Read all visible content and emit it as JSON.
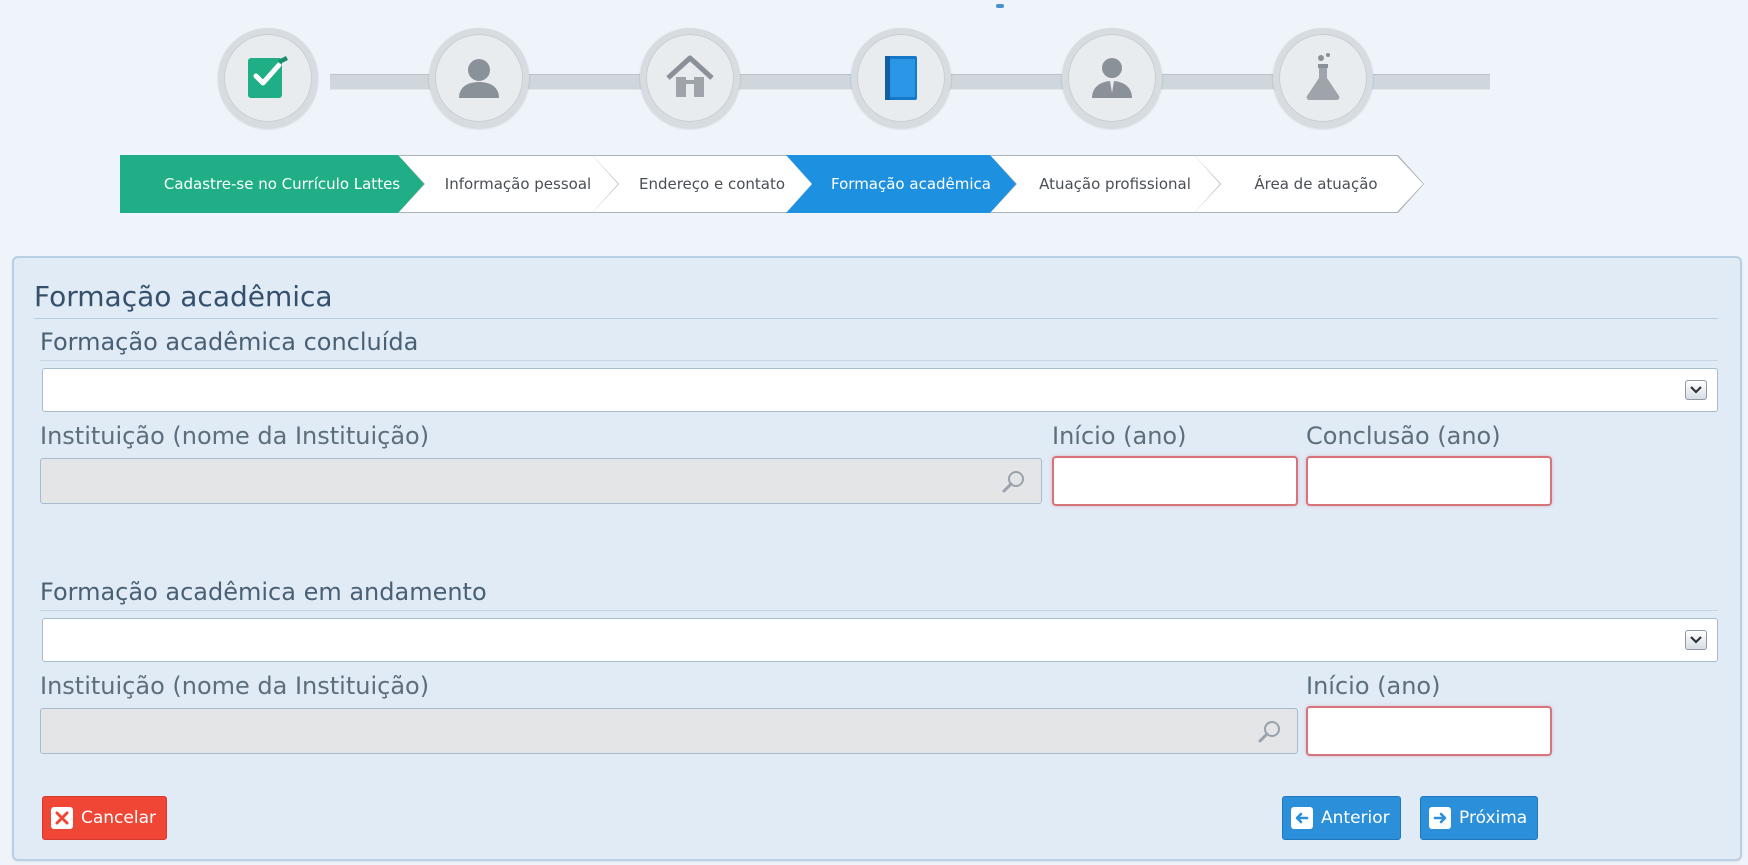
{
  "steps": [
    {
      "label": "Cadastre-se no Currículo Lattes",
      "icon": "edit-document-icon",
      "state": "done"
    },
    {
      "label": "Informação pessoal",
      "icon": "person-icon",
      "state": "pending"
    },
    {
      "label": "Endereço e contato",
      "icon": "house-icon",
      "state": "pending"
    },
    {
      "label": "Formação acadêmica",
      "icon": "book-icon",
      "state": "active"
    },
    {
      "label": "Atuação profissional",
      "icon": "businessman-icon",
      "state": "pending"
    },
    {
      "label": "Área de atuação",
      "icon": "flask-icon",
      "state": "pending"
    }
  ],
  "colors": {
    "done": "#1fae86",
    "active": "#1e90e0",
    "cancel": "#ef4636",
    "nav": "#2b8fd9",
    "required_border": "#d6737b"
  },
  "panel": {
    "title": "Formação acadêmica",
    "completed": {
      "heading": "Formação acadêmica concluída",
      "select_value": "",
      "institution_label": "Instituição (nome da Instituição)",
      "institution_value": "",
      "start_label": "Início (ano)",
      "start_value": "",
      "end_label": "Conclusão (ano)",
      "end_value": ""
    },
    "in_progress": {
      "heading": "Formação acadêmica em andamento",
      "select_value": "",
      "institution_label": "Instituição (nome da Instituição)",
      "institution_value": "",
      "start_label": "Início (ano)",
      "start_value": ""
    }
  },
  "buttons": {
    "cancel": "Cancelar",
    "previous": "Anterior",
    "next": "Próxima"
  }
}
